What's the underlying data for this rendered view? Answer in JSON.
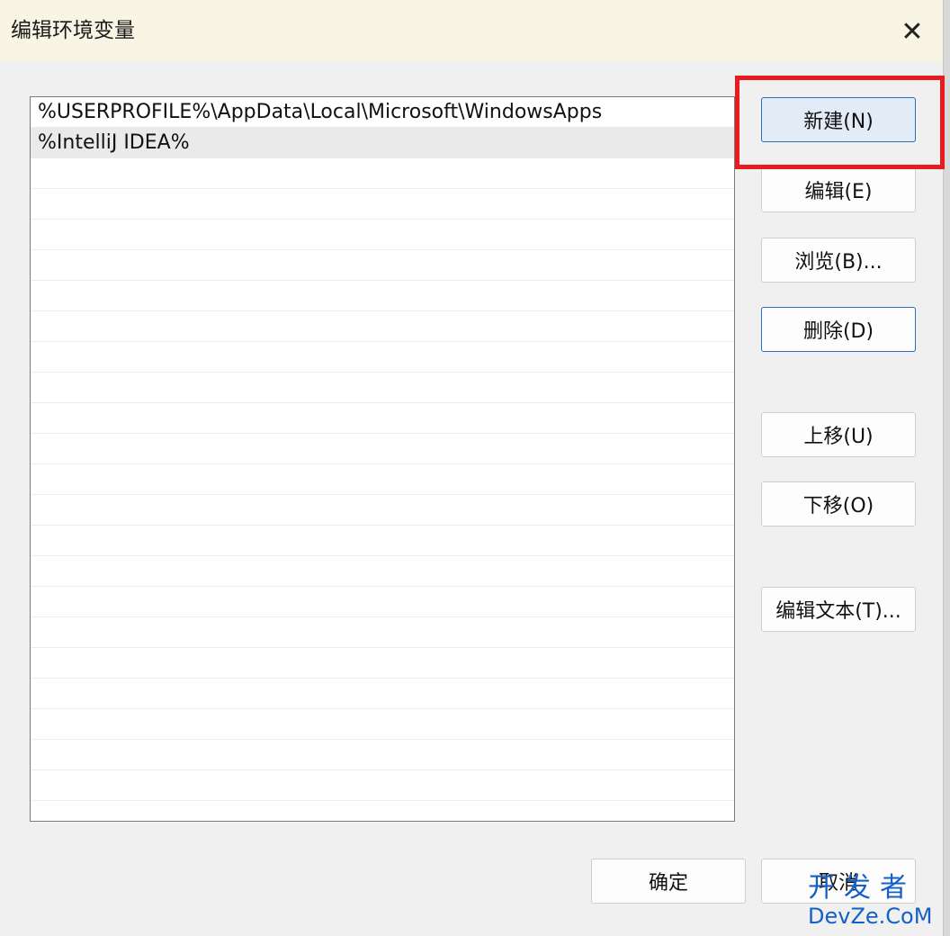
{
  "dialog": {
    "title": "编辑环境变量",
    "close_symbol": "✕"
  },
  "list": {
    "items": [
      "%USERPROFILE%\\AppData\\Local\\Microsoft\\WindowsApps",
      "%IntelliJ IDEA%"
    ],
    "selected_index": 1
  },
  "buttons": {
    "new": "新建(N)",
    "edit": "编辑(E)",
    "browse": "浏览(B)...",
    "delete": "删除(D)",
    "move_up": "上移(U)",
    "move_down": "下移(O)",
    "edit_text": "编辑文本(T)...",
    "ok": "确定",
    "cancel": "取消"
  },
  "annotation": {
    "color": "#e81a22"
  },
  "watermark": {
    "cn": "开发者",
    "en": "DevZe.CoM"
  }
}
